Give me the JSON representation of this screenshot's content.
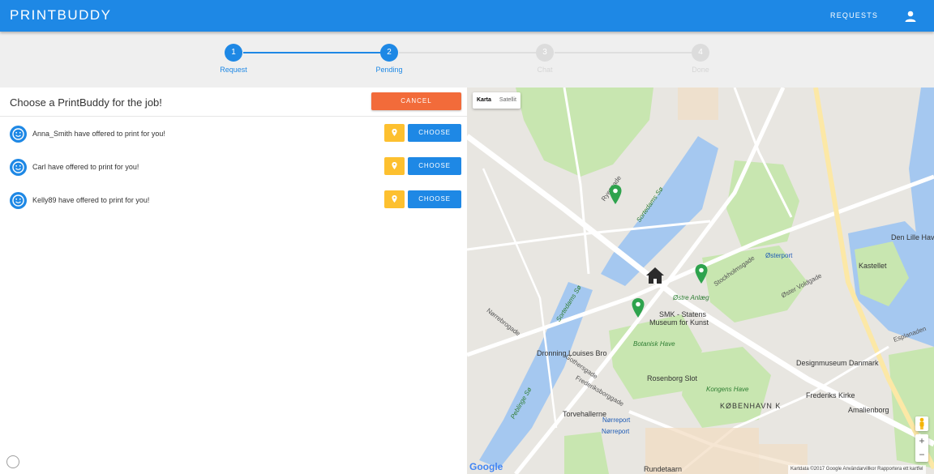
{
  "app": {
    "brand": "PRINTBUDDY"
  },
  "nav": {
    "requests_label": "REQUESTS",
    "user_icon": "user-icon"
  },
  "colors": {
    "primary": "#1e88e5",
    "cancel": "#f26b3a",
    "pin": "#fdc02f",
    "marker": "#2ea34d",
    "park": "#c8e6b0",
    "water": "#a5c8f0"
  },
  "stepper": {
    "steps": [
      {
        "number": "1",
        "label": "Request",
        "state": "active"
      },
      {
        "number": "2",
        "label": "Pending",
        "state": "active"
      },
      {
        "number": "3",
        "label": "Chat",
        "state": "inactive"
      },
      {
        "number": "4",
        "label": "Done",
        "state": "inactive"
      }
    ]
  },
  "panel": {
    "title": "Choose a PrintBuddy for the job!",
    "cancel_label": "CANCEL",
    "offers": [
      {
        "text": "Anna_Smith have offered to print for you!",
        "choose_label": "CHOOSE",
        "icon": "smiley-icon",
        "pin_icon": "map-pin-icon"
      },
      {
        "text": "Carl have offered to print for you!",
        "choose_label": "CHOOSE",
        "icon": "smiley-icon",
        "pin_icon": "map-pin-icon"
      },
      {
        "text": "Kelly89 have offered to print for you!",
        "choose_label": "CHOOSE",
        "icon": "smiley-icon",
        "pin_icon": "map-pin-icon"
      }
    ]
  },
  "map": {
    "map_type": {
      "map": "Karta",
      "satellite": "Satellit"
    },
    "labels": {
      "dronning": "Dronning Louises Bro",
      "smk": "SMK - Statens",
      "smk2": "Museum for Kunst",
      "botanisk": "Botanisk Have",
      "rosenborg": "Rosenborg Slot",
      "kongens": "Kongens Have",
      "kobenhavn": "KØBENHAVN K",
      "design": "Designmuseum Danmark",
      "frederiks": "Frederiks Kirke",
      "amalienborg": "Amalienborg",
      "kastellet": "Kastellet",
      "denlille": "Den Lille Havfru",
      "torvehallerne": "Torvehallerne",
      "norreport1": "Nørreport",
      "norreport2": "Nørreport",
      "rundetaarn": "Rundetaarn",
      "ostreanlaeg": "Østre Anlæg",
      "osterport": "Østerport",
      "peblinge": "Peblinge Sø",
      "sortedams": "Sortedams Sø",
      "sortedams2": "Sortedams Sø",
      "gothersgade": "Gothersgade",
      "ryesgade": "Ryesgade",
      "stockholmsgade": "Stockholmsgade",
      "ostervoldgade": "Øster Voldgade",
      "frederiksborggade": "Frederiksborggade",
      "norrebrogade": "Nørrebrogade",
      "esplanaden": "Esplanaden"
    },
    "zoom_in": "+",
    "zoom_out": "−",
    "google": "Google",
    "footer": "Kartdata ©2017 Google   Användarvillkor   Rapportera ett kartfel"
  }
}
